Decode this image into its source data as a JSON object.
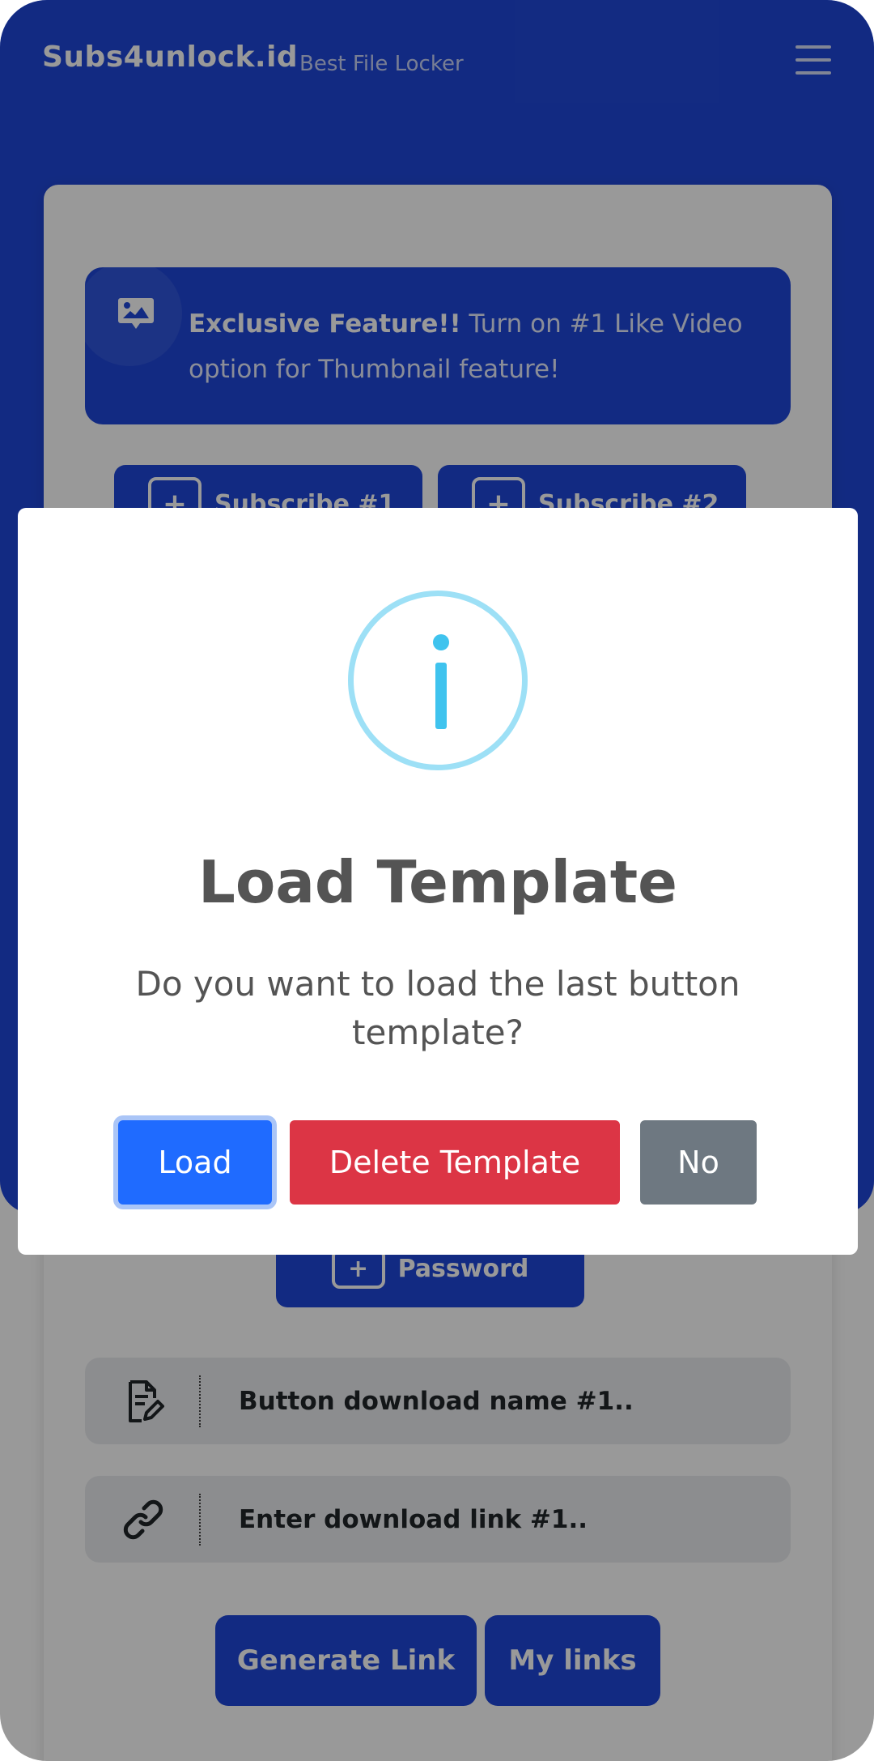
{
  "header": {
    "brand": "Subs4unlock.id",
    "tagline": "Best File Locker"
  },
  "feature_banner": {
    "bold": "Exclusive Feature!!",
    "text": " Turn on #1 Like Video option for Thumbnail feature!"
  },
  "buttons": {
    "subscribe_1": "Subscribe #1",
    "subscribe_2": "Subscribe #2",
    "password": "Password",
    "plus": "+"
  },
  "fields": {
    "button_name_placeholder": "Button download name #1..",
    "download_link_placeholder": "Enter download link #1.."
  },
  "actions": {
    "generate": "Generate Link",
    "my_links": "My links"
  },
  "modal": {
    "title": "Load Template",
    "body": "Do you want to load the last button template?",
    "load": "Load",
    "delete": "Delete Template",
    "no": "No"
  },
  "colors": {
    "primary": "#1f47d9",
    "load_button": "#1f6bff",
    "danger": "#dc3545",
    "secondary": "#6e7881",
    "info": "#3fc3ee"
  },
  "icons": [
    "menu-icon",
    "image-icon",
    "plus-icon",
    "edit-document-icon",
    "link-icon",
    "info-icon"
  ]
}
